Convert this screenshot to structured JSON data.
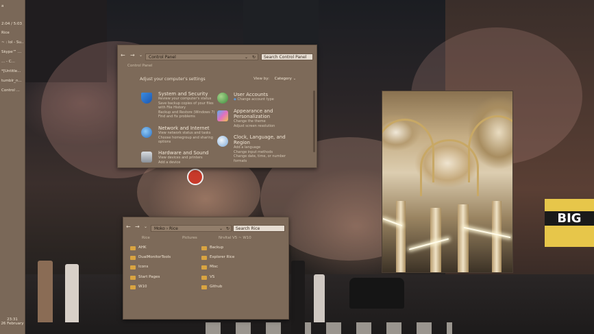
{
  "taskbar": {
    "workspace": "a",
    "items": [
      "2:04 / 5:03 / ...",
      "Rice",
      "~ : lol - Su...",
      "Skype™ ...",
      "... - C...",
      "*[Untitle...",
      "tumblr_n...",
      "Control ..."
    ],
    "time": "23:31",
    "date": "26 February"
  },
  "control_panel": {
    "address": "Control Panel",
    "search_placeholder": "Search Control Panel",
    "breadcrumb": "Control Panel",
    "heading": "Adjust your computer's settings",
    "view_by_label": "View by:",
    "view_by_value": "Category",
    "left_categories": [
      {
        "title": "System and Security",
        "icon": "shield-icon",
        "lines": [
          "Review your computer's status",
          "Save backup copies of your files",
          "with File History",
          "Backup and Restore (Windows 7)",
          "Find and fix problems"
        ]
      },
      {
        "title": "Network and Internet",
        "icon": "network-globe-icon",
        "lines": [
          "View network status and tasks",
          "Choose homegroup and sharing",
          "options"
        ]
      },
      {
        "title": "Hardware and Sound",
        "icon": "printer-icon",
        "lines": [
          "View devices and printers",
          "Add a device"
        ]
      }
    ],
    "right_categories": [
      {
        "title": "User Accounts",
        "icon": "users-icon",
        "lines": [
          "Change account type"
        ]
      },
      {
        "title": "Appearance and",
        "title2": "Personalization",
        "icon": "monitor-icon",
        "lines": [
          "Change the theme",
          "Adjust screen resolution"
        ]
      },
      {
        "title": "Clock, Language, and",
        "title2": "Region",
        "icon": "clock-globe-icon",
        "lines": [
          "Add a language",
          "Change input methods",
          "Change date, time, or number",
          "formats"
        ]
      }
    ]
  },
  "explorer": {
    "address_parts": [
      "Moko",
      "Rice"
    ],
    "search_placeholder": "Search Rice",
    "columns": [
      "Rice",
      "Pictures",
      "Nrvltal V5 ~ W10"
    ],
    "folders_left": [
      "AHK",
      "DualMonitorTools",
      "Icons",
      "Start Pages",
      "W10"
    ],
    "folders_right": [
      "Backup",
      "Explorer Rice",
      "Misc",
      "VS",
      "Github"
    ],
    "colors": {
      "folder": "#d9a441"
    }
  },
  "billboard": {
    "text": "BIG"
  }
}
